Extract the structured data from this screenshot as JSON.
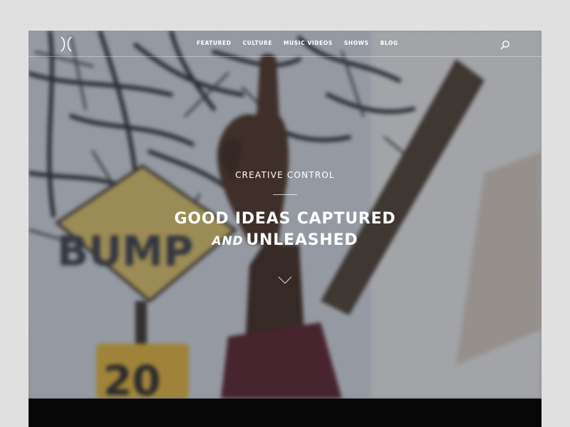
{
  "nav": {
    "items": [
      {
        "label": "FEATURED"
      },
      {
        "label": "CULTURE"
      },
      {
        "label": "MUSIC VIDEOS"
      },
      {
        "label": "SHOWS"
      },
      {
        "label": "BLOG"
      }
    ],
    "search_icon": "search-icon",
    "logo_icon": "logo-icon"
  },
  "hero": {
    "kicker": "CREATIVE CONTROL",
    "headline_line1": "GOOD IDEAS CAPTURED",
    "headline_and": "AND",
    "headline_line2": "UNLEASHED",
    "scroll_icon": "chevron-down-icon",
    "sign_bump": "BUMP",
    "sign_speed": "20"
  },
  "colors": {
    "text": "#ffffff",
    "bottom_bar": "#060606",
    "page_bg": "#e4e4e4"
  }
}
